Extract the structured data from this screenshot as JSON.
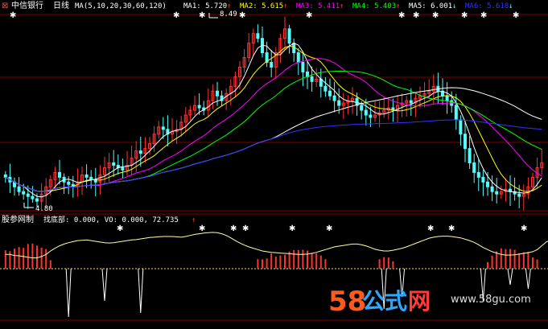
{
  "header": {
    "stock_name": "中信银行",
    "period": "日线",
    "ma_params": "MA(5,10,20,30,60,120)",
    "items": [
      {
        "label": "MA1: 5.720",
        "color": "#ffffff"
      },
      {
        "label": "MA2: 5.615",
        "color": "#ffff00"
      },
      {
        "label": "MA3: 5.411",
        "color": "#ff00ff"
      },
      {
        "label": "MA4: 5.403",
        "color": "#00ff00"
      },
      {
        "label": "MA5: 6.001",
        "color": "#ffffff"
      },
      {
        "label": "MA6: 5.618",
        "color": "#3333ff"
      }
    ],
    "arrows": [
      "↑",
      "↑",
      "↑",
      "↑",
      "↓",
      "↓"
    ]
  },
  "annotations": {
    "high": "8.49",
    "low": "4.80"
  },
  "indicator": {
    "name": "股参网制",
    "text": "找底部: 0.000, VO: 0.000, 72.735",
    "arrow": "↑"
  },
  "watermark": {
    "number": "58",
    "chinese": "公式",
    "wang": "网",
    "url": "www.58gu.com"
  },
  "colors": {
    "up": "#ff3232",
    "down": "#54fcfc",
    "ma1": "#ffffff",
    "ma2": "#ffff00",
    "ma3": "#ff00ff",
    "ma4": "#00ff00",
    "ma5": "#ffffff",
    "ma6": "#3333ff",
    "grid": "#800000",
    "indicator_line": "#ffffaa",
    "star": "#ffffff"
  },
  "chart_data": {
    "type": "line",
    "price_range": [
      4.6,
      8.7
    ],
    "close": [
      5.3,
      5.2,
      5.1,
      5.0,
      4.95,
      4.9,
      4.85,
      4.8,
      4.95,
      5.1,
      5.25,
      5.4,
      5.3,
      5.2,
      5.15,
      5.1,
      5.2,
      5.35,
      5.3,
      5.25,
      5.2,
      5.35,
      5.5,
      5.6,
      5.55,
      5.5,
      5.45,
      5.55,
      5.7,
      5.85,
      5.8,
      5.9,
      6.0,
      6.2,
      6.35,
      6.3,
      6.2,
      6.25,
      6.3,
      6.45,
      6.6,
      6.7,
      6.8,
      6.75,
      6.7,
      6.9,
      7.1,
      7.0,
      6.9,
      7.05,
      7.2,
      7.4,
      7.6,
      7.8,
      8.1,
      8.3,
      8.2,
      7.9,
      7.7,
      7.6,
      7.9,
      8.2,
      8.4,
      8.1,
      7.9,
      7.7,
      7.5,
      7.4,
      7.3,
      7.35,
      7.2,
      7.1,
      7.0,
      6.9,
      6.8,
      6.85,
      6.9,
      6.95,
      6.8,
      6.7,
      6.6,
      6.55,
      6.6,
      6.65,
      6.7,
      6.75,
      6.7,
      6.8,
      6.85,
      6.9,
      6.85,
      6.95,
      7.0,
      7.05,
      7.1,
      7.2,
      7.1,
      7.0,
      6.9,
      6.8,
      6.5,
      6.2,
      5.9,
      5.6,
      5.4,
      5.3,
      5.2,
      5.1,
      5.0,
      4.95,
      5.0,
      5.05,
      5.0,
      4.95,
      4.9,
      4.95,
      5.1,
      5.3,
      5.5,
      5.6
    ],
    "ma_periods": [
      5,
      10,
      20,
      30,
      60,
      120
    ],
    "ma_last": [
      5.72,
      5.615,
      5.411,
      5.403,
      6.001,
      5.618
    ],
    "indicator_range": [
      -100,
      110
    ],
    "indicator_line": [
      30,
      30,
      27,
      26,
      24,
      22,
      20,
      20,
      24,
      30,
      40,
      48,
      55,
      60,
      64,
      67,
      70,
      71,
      72,
      70,
      68,
      66,
      64,
      63,
      64,
      66,
      68,
      70,
      72,
      73,
      75,
      77,
      79,
      80,
      81,
      82,
      82,
      82,
      81,
      80,
      82,
      85,
      88,
      90,
      92,
      93,
      94,
      93,
      90,
      85,
      78,
      70,
      63,
      57,
      52,
      48,
      44,
      40,
      38,
      36,
      35,
      34,
      33,
      32,
      31,
      30,
      30,
      31,
      33,
      36,
      40,
      44,
      48,
      52,
      54,
      56,
      58,
      60,
      60,
      58,
      55,
      50,
      45,
      42,
      40,
      40,
      42,
      45,
      48,
      52,
      57,
      62,
      67,
      72,
      77,
      80,
      82,
      83,
      83,
      82,
      80,
      78,
      74,
      70,
      65,
      58,
      50,
      44,
      38,
      34,
      30,
      28,
      28,
      29,
      31,
      33,
      35,
      38,
      44,
      55,
      66,
      72.735
    ]
  }
}
